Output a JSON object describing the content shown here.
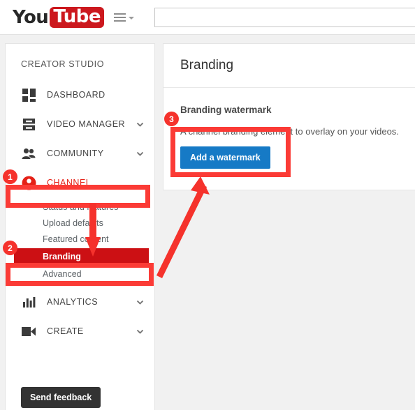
{
  "header": {
    "logo_you": "You",
    "logo_tube": "Tube",
    "menu_icon": "hamburger-menu-icon",
    "caret_icon": "chevron-down-icon",
    "search_value": "",
    "search_placeholder": ""
  },
  "sidebar": {
    "title": "CREATOR STUDIO",
    "items": [
      {
        "label": "DASHBOARD",
        "icon": "dashboard-grid-icon",
        "expandable": false,
        "active": false
      },
      {
        "label": "VIDEO MANAGER",
        "icon": "video-list-icon",
        "expandable": true,
        "active": false
      },
      {
        "label": "COMMUNITY",
        "icon": "people-icon",
        "expandable": true,
        "active": false
      },
      {
        "label": "CHANNEL",
        "icon": "person-avatar-icon",
        "expandable": false,
        "active": true
      },
      {
        "label": "ANALYTICS",
        "icon": "bar-chart-icon",
        "expandable": true,
        "active": false
      },
      {
        "label": "CREATE",
        "icon": "video-camera-icon",
        "expandable": true,
        "active": false
      }
    ],
    "channel_subitems": [
      {
        "label": "Status and features",
        "active": false
      },
      {
        "label": "Upload defaults",
        "active": false
      },
      {
        "label": "Featured content",
        "active": false
      },
      {
        "label": "Branding",
        "active": true
      },
      {
        "label": "Advanced",
        "active": false
      }
    ],
    "send_feedback_label": "Send feedback"
  },
  "main": {
    "page_title": "Branding",
    "section_title": "Branding watermark",
    "section_description": "A channel branding element to overlay on your videos.",
    "add_watermark_label": "Add a watermark"
  },
  "annotations": {
    "badges": [
      {
        "number": "1",
        "target": "channel-nav-item"
      },
      {
        "number": "2",
        "target": "branding-subitem"
      },
      {
        "number": "3",
        "target": "add-watermark-area"
      }
    ],
    "highlight_color": "#fb3b36",
    "arrow_color": "#f5322c"
  },
  "colors": {
    "youtube_red": "#cc181e",
    "accent_blue": "#167ac6",
    "active_red": "#cc1014",
    "annotation_red": "#f5322c",
    "page_background": "#f1f1f1",
    "feedback_dark": "#333333"
  }
}
